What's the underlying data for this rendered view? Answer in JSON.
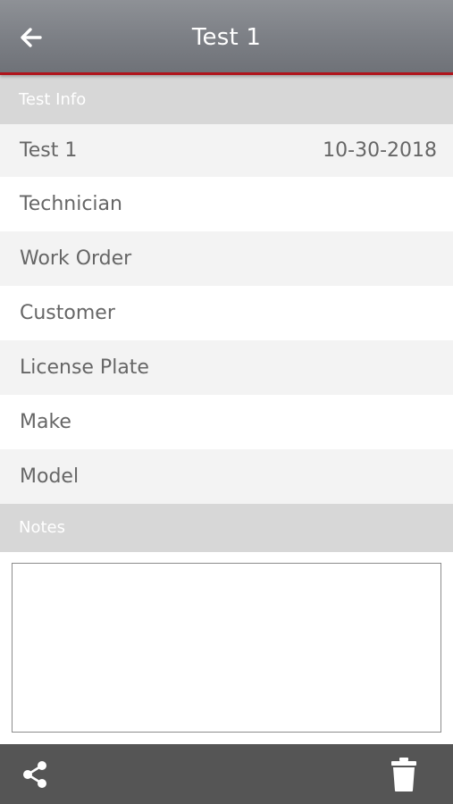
{
  "header": {
    "title": "Test 1",
    "back_icon": "arrow-left-icon"
  },
  "test_info": {
    "section_label": "Test Info",
    "rows": [
      {
        "label": "Test 1",
        "value": "10-30-2018"
      },
      {
        "label": "Technician",
        "value": ""
      },
      {
        "label": "Work Order",
        "value": ""
      },
      {
        "label": "Customer",
        "value": ""
      },
      {
        "label": "License Plate",
        "value": ""
      },
      {
        "label": "Make",
        "value": ""
      },
      {
        "label": "Model",
        "value": ""
      }
    ]
  },
  "notes": {
    "section_label": "Notes",
    "value": ""
  },
  "footer": {
    "share_icon": "share-icon",
    "delete_icon": "trash-icon"
  },
  "colors": {
    "header_background": "#7d8086",
    "header_accent": "#b0141c",
    "section_header_background": "#d7d7d7",
    "footer_background": "#555555",
    "row_text": "#666666"
  }
}
